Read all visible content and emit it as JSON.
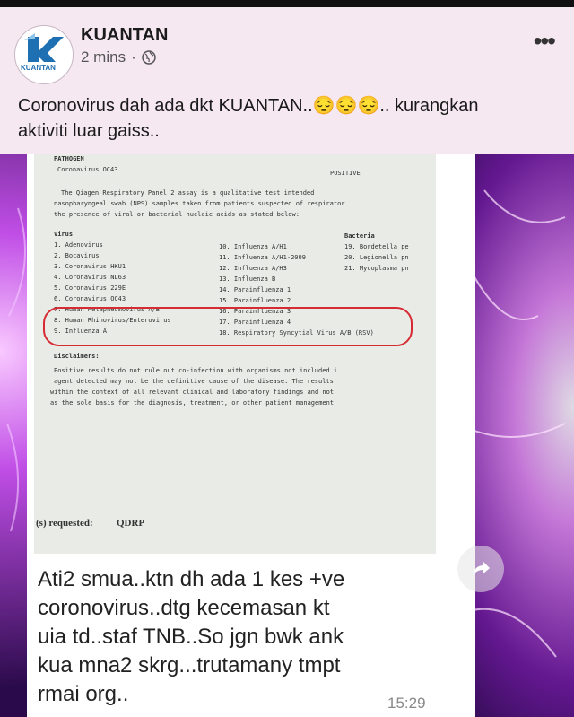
{
  "post": {
    "page_name": "KUANTAN",
    "time_ago": "2 mins",
    "separator": "·",
    "avatar_text": "KUANTAN",
    "caption_line1": "Coronovirus dah ada dkt KUANTAN..😔😔😔.. kurangkan",
    "caption_line2": "aktiviti luar gaiss.."
  },
  "photo": {
    "doc": {
      "pathogen_label": "PATHOGEN",
      "pathogen": "Coronavirus OC43",
      "result": "POSITIVE",
      "desc1": "The Qiagen Respiratory Panel 2 assay is a qualitative test intended",
      "desc2": "nasopharyngeal swab (NPS) samples taken from patients suspected of respirator",
      "desc3": "the presence of viral or bacterial nucleic acids as stated below:",
      "virus_header": "Virus",
      "bacteria_header": "Bacteria",
      "virus_col1": [
        "1. Adenovirus",
        "2. Bocavirus",
        "3. Coronavirus HKU1",
        "4. Coronavirus NL63",
        "5. Coronavirus 229E",
        "6. Coronavirus OC43",
        "7. Human Metapneumovirus A/B",
        "8. Human Rhinovirus/Enterovirus",
        "9. Influenza A"
      ],
      "virus_col2": [
        "10. Influenza A/H1",
        "11. Influenza A/H1-2009",
        "12. Influenza A/H3",
        "13. Influenza B",
        "14. Parainfluenza 1",
        "15. Parainfluenza 2",
        "16. Parainfluenza 3",
        "17. Parainfluenza 4",
        "18. Respiratory Syncytial Virus A/B (RSV)"
      ],
      "bacteria_col": [
        "19. Bordetella pe",
        "20. Legionella pn",
        "21. Mycoplasma pn"
      ],
      "disclaimer_header": "Disclaimers:",
      "disc1": "Positive results do not rule out co-infection with organisms not included i",
      "disc2": "agent detected may not be the definitive cause of the disease. The results",
      "disc3": "within the context of all relevant clinical and laboratory findings and not",
      "disc4": "as the sole basis for the diagnosis, treatment, or other patient management",
      "requested_label": "(s) requested:",
      "requested_value": "QDRP"
    },
    "message": {
      "text_line1": "Ati2 smua..ktn dh ada 1 kes +ve",
      "text_line2": "coronovirus..dtg kecemasan kt",
      "text_line3": "uia td..staf TNB..So jgn bwk ank",
      "text_line4": "kua mna2 skrg...trutamany tmpt",
      "text_line5": "rmai org..",
      "time": "15:29"
    }
  },
  "icons": {
    "more": "more-options-icon",
    "globe": "globe-icon",
    "share": "share-icon"
  },
  "colors": {
    "highlight": "#d62b33",
    "background": "#f6e8f1",
    "plasma": "#b03cd8"
  }
}
